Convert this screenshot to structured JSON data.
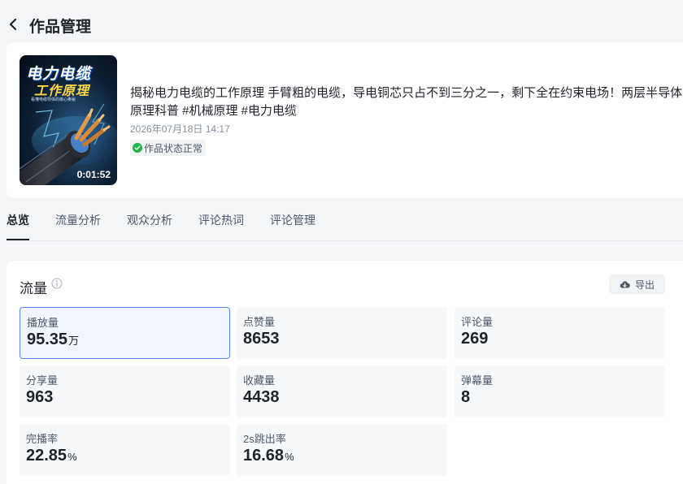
{
  "header": {
    "title": "作品管理"
  },
  "work": {
    "cover": {
      "title_line1": "电力电缆",
      "title_line2": "工作原理",
      "subtitle": "看懂电缆导体的核心奥秘",
      "duration": "0:01:52"
    },
    "description_line1": "揭秘电力电缆的工作原理 手臂粗的电缆，导电铜芯只占不到三分之一，剩下全在约束电场！两层半导体",
    "description_line2": "原理科普 #机械原理 #电力电缆",
    "publish_time": "2026年07月18日 14:17",
    "status": "作品状态正常",
    "status_color": "#1fb34a"
  },
  "tabs": [
    {
      "label": "总览",
      "active": true
    },
    {
      "label": "流量分析"
    },
    {
      "label": "观众分析"
    },
    {
      "label": "评论热词"
    },
    {
      "label": "评论管理"
    }
  ],
  "traffic": {
    "title": "流量",
    "export_label": "导出",
    "metrics": [
      {
        "label": "播放量",
        "value": "95.35",
        "unit": "万"
      },
      {
        "label": "点赞量",
        "value": "8653",
        "unit": ""
      },
      {
        "label": "评论量",
        "value": "269",
        "unit": ""
      },
      {
        "label": "分享量",
        "value": "963",
        "unit": ""
      },
      {
        "label": "收藏量",
        "value": "4438",
        "unit": ""
      },
      {
        "label": "弹幕量",
        "value": "8",
        "unit": ""
      },
      {
        "label": "完播率",
        "value": "22.85",
        "unit": "%"
      },
      {
        "label": "2s跳出率",
        "value": "16.68",
        "unit": "%"
      }
    ]
  },
  "colors": {
    "accent": "#5b87ff",
    "selected_bg": "#f0f5ff"
  }
}
